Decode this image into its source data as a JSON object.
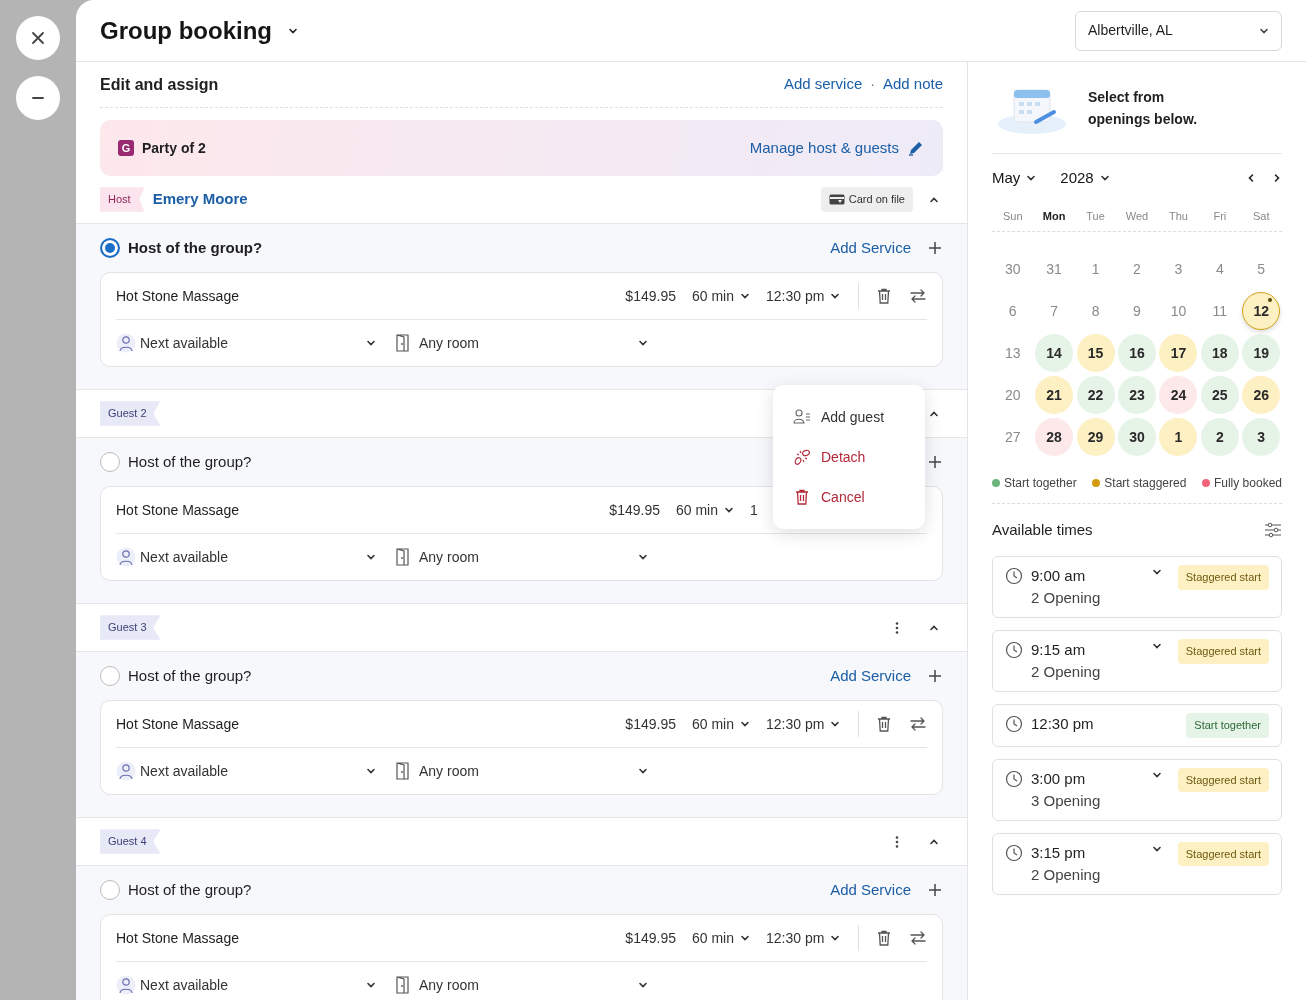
{
  "side_buttons": [
    {
      "kind": "close"
    },
    {
      "kind": "minimize"
    }
  ],
  "header": {
    "title": "Group booking",
    "location": "Albertville, AL"
  },
  "edit": {
    "title": "Edit and assign",
    "links": [
      "Add service",
      "Add note"
    ],
    "separator": "·",
    "party": {
      "badge": "G",
      "label": "Party of 2",
      "manage": "Manage host & guests"
    }
  },
  "guests": [
    {
      "tag": "Host",
      "kind": "host",
      "name": "Emery Moore",
      "card": "Card on file",
      "menu_button": false,
      "expanded": true,
      "host_question": "Host of the group?",
      "selected": true,
      "add_service": "Add Service",
      "service": {
        "name": "Hot Stone Massage",
        "price": "$149.95",
        "duration": "60 min",
        "time": "12:30 pm",
        "actions": true,
        "staff": "Next available",
        "room": "Any room"
      }
    },
    {
      "tag": "Guest 2",
      "kind": "guest",
      "menu_button": false,
      "expanded": true,
      "host_question": "Host of the group?",
      "selected": false,
      "service": {
        "name": "Hot Stone Massage",
        "price": "$149.95",
        "duration": "60 min",
        "time": "1",
        "actions": false,
        "staff": "Next available",
        "room": "Any room"
      }
    },
    {
      "tag": "Guest 3",
      "kind": "guest",
      "menu_button": true,
      "expanded": true,
      "host_question": "Host of the group?",
      "selected": false,
      "add_service": "Add Service",
      "service": {
        "name": "Hot Stone Massage",
        "price": "$149.95",
        "duration": "60 min",
        "time": "12:30 pm",
        "actions": true,
        "staff": "Next available",
        "room": "Any room"
      }
    },
    {
      "tag": "Guest 4",
      "kind": "guest",
      "menu_button": true,
      "expanded": true,
      "host_question": "Host of the group?",
      "selected": false,
      "add_service": "Add Service",
      "service": {
        "name": "Hot Stone Massage",
        "price": "$149.95",
        "duration": "60 min",
        "time": "12:30 pm",
        "actions": true,
        "staff": "Next available",
        "room": "Any room"
      }
    }
  ],
  "menu": [
    {
      "label": "Add guest",
      "kind": "add"
    },
    {
      "label": "Detach",
      "kind": "detach"
    },
    {
      "label": "Cancel",
      "kind": "cancel"
    }
  ],
  "calendar": {
    "intro": "Select from openings below.",
    "month": "May",
    "year": "2028",
    "weekdays": [
      {
        "label": "Sun",
        "today": false
      },
      {
        "label": "Mon",
        "today": true
      },
      {
        "label": "Tue",
        "today": false
      },
      {
        "label": "Wed",
        "today": false
      },
      {
        "label": "Thu",
        "today": false
      },
      {
        "label": "Fri",
        "today": false
      },
      {
        "label": "Sat",
        "today": false
      }
    ],
    "days": [
      {
        "day": "30",
        "kind": "past",
        "selected": false
      },
      {
        "day": "31",
        "kind": "past",
        "selected": false
      },
      {
        "day": "1",
        "kind": "past",
        "selected": false
      },
      {
        "day": "2",
        "kind": "past",
        "selected": false
      },
      {
        "day": "3",
        "kind": "past",
        "selected": false
      },
      {
        "day": "4",
        "kind": "past",
        "selected": false
      },
      {
        "day": "5",
        "kind": "past",
        "selected": false
      },
      {
        "day": "6",
        "kind": "past",
        "selected": false
      },
      {
        "day": "7",
        "kind": "past",
        "selected": false
      },
      {
        "day": "8",
        "kind": "past",
        "selected": false
      },
      {
        "day": "9",
        "kind": "past",
        "selected": false
      },
      {
        "day": "10",
        "kind": "past",
        "selected": false
      },
      {
        "day": "11",
        "kind": "past",
        "selected": false
      },
      {
        "day": "12",
        "kind": "staggered",
        "selected": true
      },
      {
        "day": "13",
        "kind": "past",
        "selected": false
      },
      {
        "day": "14",
        "kind": "together",
        "selected": false
      },
      {
        "day": "15",
        "kind": "staggered",
        "selected": false
      },
      {
        "day": "16",
        "kind": "together",
        "selected": false
      },
      {
        "day": "17",
        "kind": "staggered",
        "selected": false
      },
      {
        "day": "18",
        "kind": "together",
        "selected": false
      },
      {
        "day": "19",
        "kind": "together",
        "selected": false
      },
      {
        "day": "20",
        "kind": "past",
        "selected": false
      },
      {
        "day": "21",
        "kind": "staggered",
        "selected": false
      },
      {
        "day": "22",
        "kind": "together",
        "selected": false
      },
      {
        "day": "23",
        "kind": "together",
        "selected": false
      },
      {
        "day": "24",
        "kind": "booked",
        "selected": false
      },
      {
        "day": "25",
        "kind": "together",
        "selected": false
      },
      {
        "day": "26",
        "kind": "staggered",
        "selected": false
      },
      {
        "day": "27",
        "kind": "past",
        "selected": false
      },
      {
        "day": "28",
        "kind": "booked",
        "selected": false
      },
      {
        "day": "29",
        "kind": "staggered",
        "selected": false
      },
      {
        "day": "30",
        "kind": "together",
        "selected": false
      },
      {
        "day": "1",
        "kind": "staggered",
        "selected": false
      },
      {
        "day": "2",
        "kind": "together",
        "selected": false
      },
      {
        "day": "3",
        "kind": "together",
        "selected": false
      }
    ],
    "legend": [
      {
        "label": "Start together",
        "color": "#6cb37c"
      },
      {
        "label": "Start staggered",
        "color": "#d49b12"
      },
      {
        "label": "Fully booked",
        "color": "#f2637a"
      }
    ]
  },
  "times": {
    "title": "Available times",
    "slots": [
      {
        "time": "9:00 am",
        "openings": "2 Opening",
        "expandable": true,
        "badge": "Staggered start",
        "kind": "staggered"
      },
      {
        "time": "9:15 am",
        "openings": "2 Opening",
        "expandable": true,
        "badge": "Staggered start",
        "kind": "staggered"
      },
      {
        "time": "12:30 pm",
        "expandable": false,
        "badge": "Start together",
        "kind": "together"
      },
      {
        "time": "3:00 pm",
        "openings": "3 Opening",
        "expandable": true,
        "badge": "Staggered start",
        "kind": "staggered"
      },
      {
        "time": "3:15 pm",
        "openings": "2 Opening",
        "expandable": true,
        "badge": "Staggered start",
        "kind": "staggered"
      }
    ]
  }
}
